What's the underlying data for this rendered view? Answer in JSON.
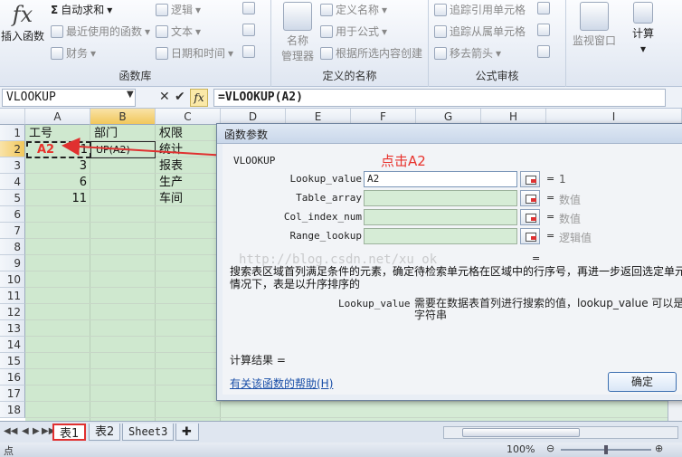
{
  "ribbon": {
    "insert_function": "插入函数",
    "autosum": "自动求和",
    "recent": "最近使用的函数",
    "financial": "财务",
    "logical": "逻辑",
    "text": "文本",
    "datetime": "日期和时间",
    "group_library": "函数库",
    "name_manager": "名称\n管理器",
    "define_name": "定义名称",
    "use_in_formula": "用于公式",
    "create_from_selection": "根据所选内容创建",
    "group_names": "定义的名称",
    "trace_precedents": "追踪引用单元格",
    "trace_dependents": "追踪从属单元格",
    "remove_arrows": "移去箭头",
    "group_audit": "公式审核",
    "watch_window": "监视窗口",
    "calculate": "计算"
  },
  "formula_bar": {
    "name_box": "VLOOKUP",
    "formula": "=VLOOKUP(A2)"
  },
  "grid": {
    "columns": [
      "A",
      "B",
      "C",
      "D",
      "E",
      "F",
      "G",
      "H",
      "I"
    ],
    "rows": [
      "1",
      "2",
      "3",
      "4",
      "5",
      "6",
      "7",
      "8",
      "9",
      "10",
      "11",
      "12",
      "13",
      "14",
      "15",
      "16",
      "17",
      "18"
    ],
    "a1": "工号",
    "b1": "部门",
    "c1": "权限",
    "a2_annot": "A2",
    "a2_tail": "1",
    "b2": "UP(A2)",
    "a3": "3",
    "a4": "6",
    "a5": "11",
    "c2": "统计",
    "c3": "报表",
    "c4": "生产",
    "c5": "车间"
  },
  "dialog": {
    "title": "函数参数",
    "function_name": "VLOOKUP",
    "click_tip": "点击A2",
    "args": [
      {
        "label": "Lookup_value",
        "input": "A2",
        "value": "1"
      },
      {
        "label": "Table_array",
        "input": "",
        "value": "数值"
      },
      {
        "label": "Col_index_num",
        "input": "",
        "value": "数值"
      },
      {
        "label": "Range_lookup",
        "input": "",
        "value": "逻辑值"
      }
    ],
    "equals": "=",
    "description": "搜索表区域首列满足条件的元素，确定待检索单元格在区域中的行序号，再进一步返回选定单元\n情况下，表是以升序排序的",
    "param_name": "Lookup_value",
    "param_desc": "需要在数据表首列进行搜索的值，lookup_value 可以是\n字符串",
    "result_label": "计算结果 =",
    "help_link": "有关该函数的帮助(H)",
    "ok": "确定",
    "watermark": "http://blog.csdn.net/xu_ok"
  },
  "sheets": {
    "tab1": "表1",
    "tab2": "表2",
    "tab3": "Sheet3"
  },
  "status": {
    "mode": "点",
    "zoom": "100%"
  }
}
